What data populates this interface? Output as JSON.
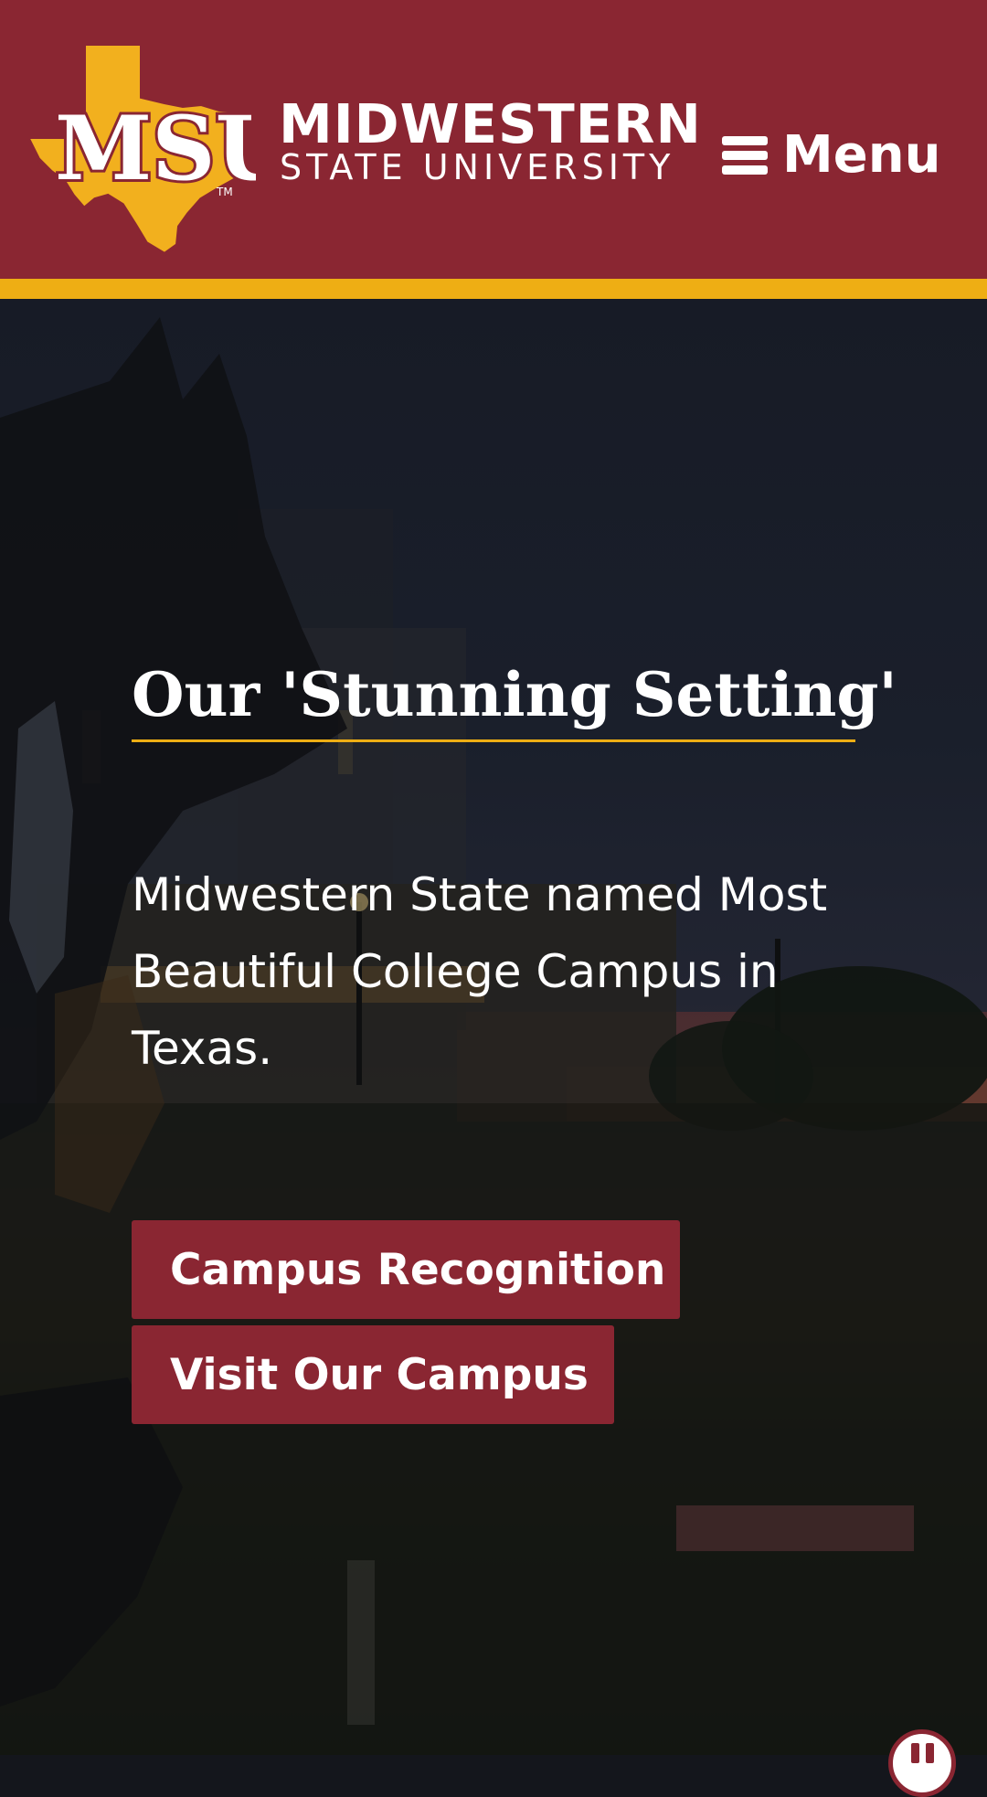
{
  "header": {
    "logo": {
      "mark_text": "MSU",
      "trademark": "TM",
      "line1": "MIDWESTERN",
      "line2": "STATE UNIVERSITY",
      "icon": "texas-state-outline-icon"
    },
    "menu": {
      "label": "Menu",
      "icon": "hamburger-icon"
    }
  },
  "hero": {
    "title": "Our 'Stunning Setting'",
    "text": "Midwestern State named Most Beautiful College Campus in Texas.",
    "buttons": [
      {
        "label": "Campus Recognition",
        "icon": "chevron-right-icon"
      },
      {
        "label": "Visit Our Campus",
        "icon": "chevron-right-icon"
      }
    ],
    "pause": {
      "icon": "pause-icon"
    }
  },
  "colors": {
    "maroon": "#8a2632",
    "gold": "#eeae14",
    "white": "#ffffff"
  }
}
